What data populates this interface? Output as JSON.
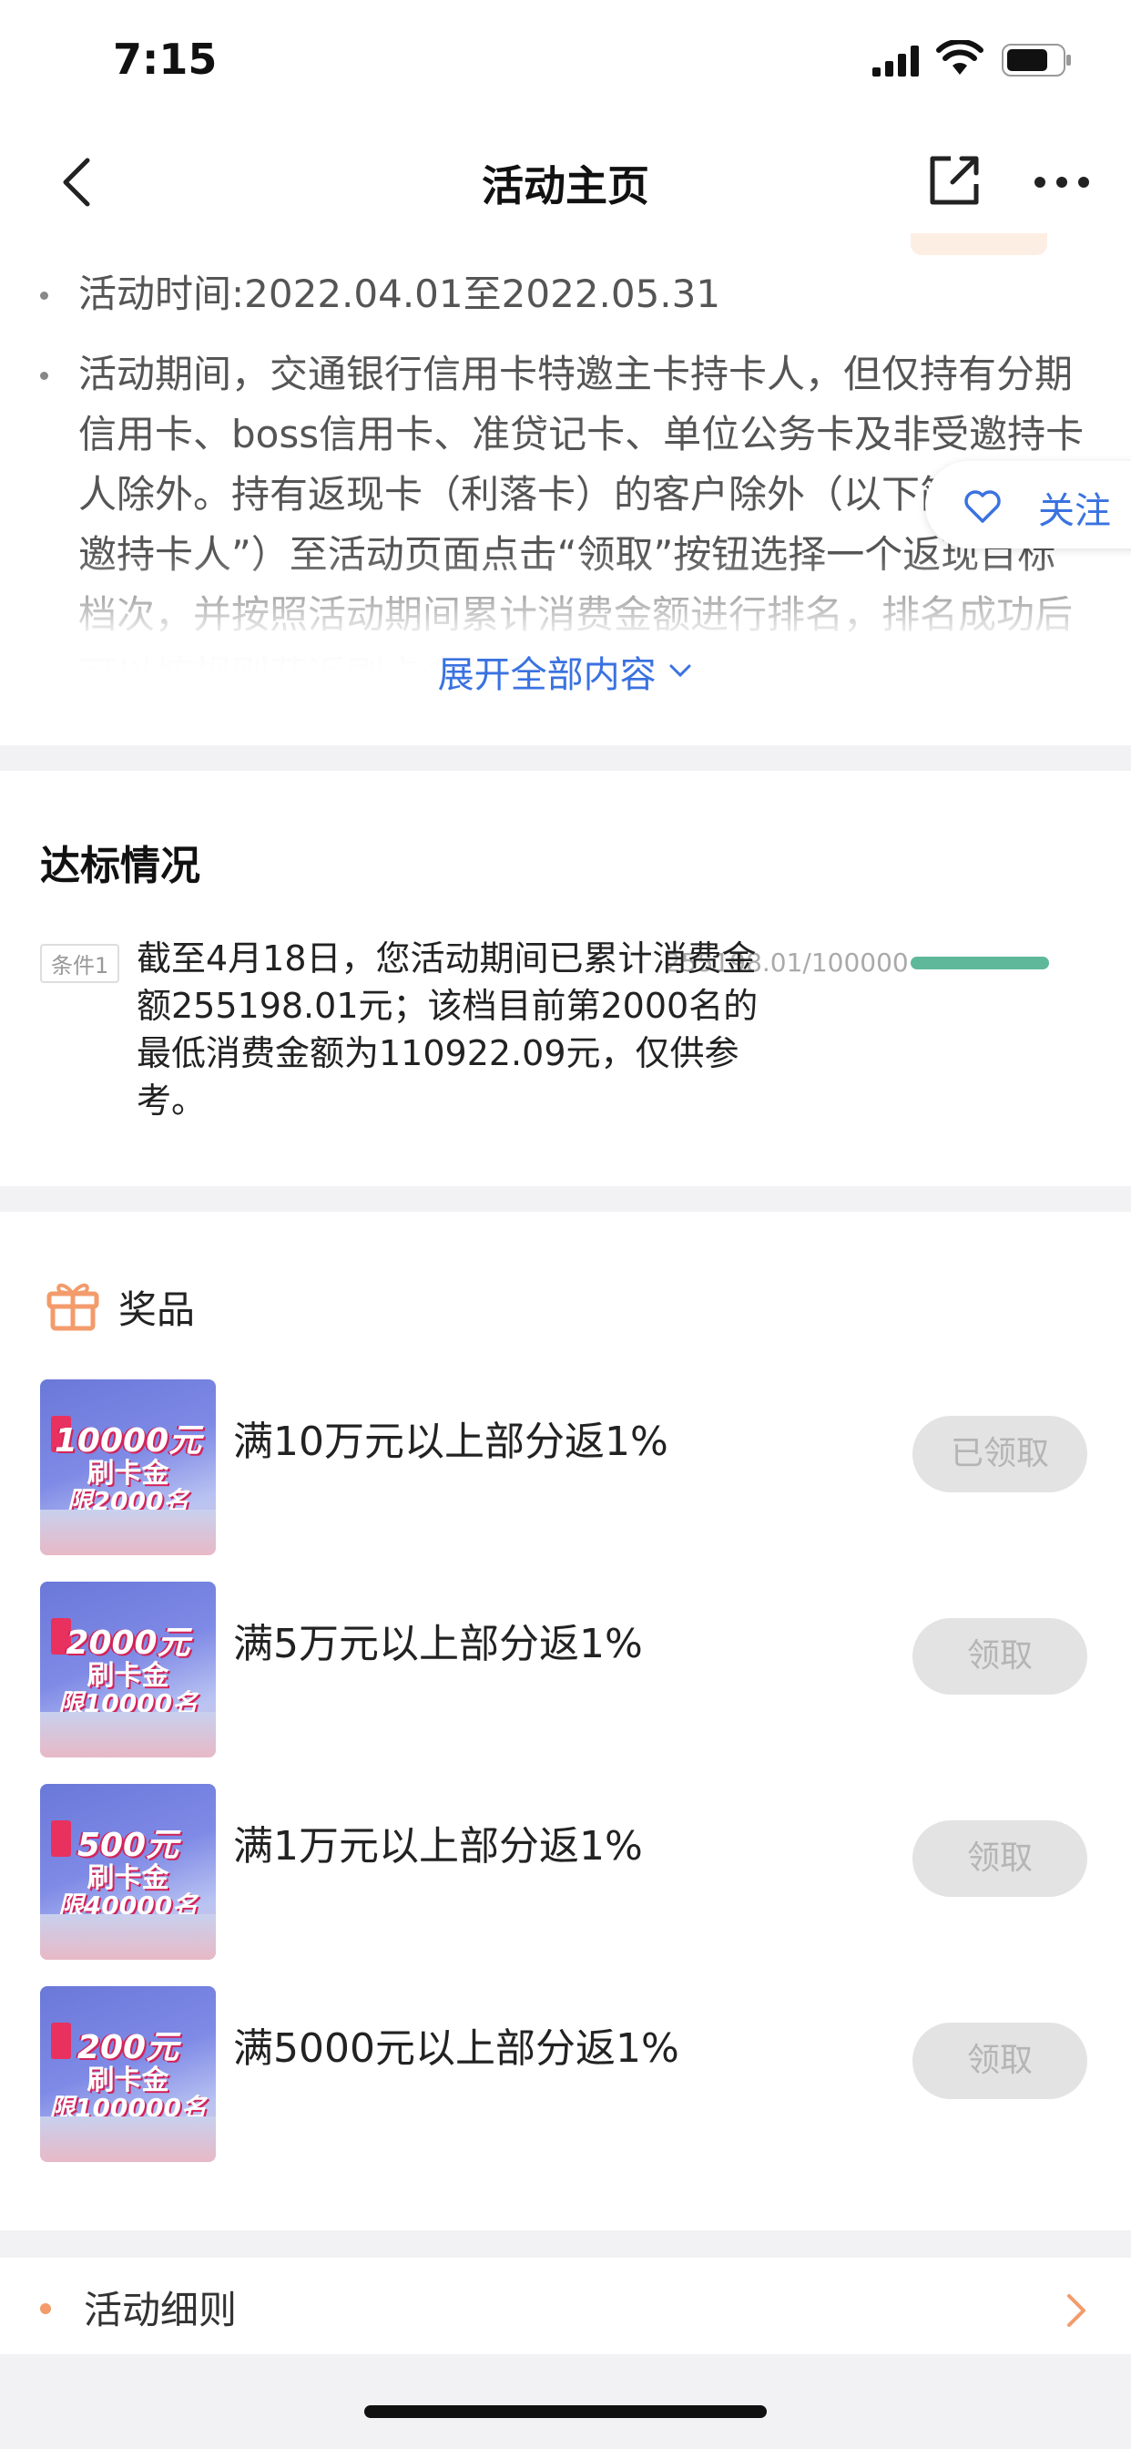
{
  "status": {
    "time": "7:15"
  },
  "nav": {
    "title": "活动主页"
  },
  "rules": {
    "items": [
      "活动时间:2022.04.01至2022.05.31",
      "活动期间，交通银行信用卡特邀主卡持卡人，但仅持有分期信用卡、boss信用卡、准贷记卡、单位公务卡及非受邀持卡人除外。持有返现卡（利落卡）的客户除外（以下简称“特邀持卡人”）至活动页面点击“领取”按钮选择一个返现目标档次，并按照活动期间累计消费金额进行排名，排名成功后可以按规则获返刷卡金奖励"
    ],
    "expand_label": "展开全部内容"
  },
  "follow": {
    "label": "关注"
  },
  "status_section": {
    "title": "达标情况",
    "condition": {
      "badge": "条件1",
      "text": "截至4月18日，您活动期间已累计消费金额255198.01元；该档目前第2000名的最低消费金额为110922.09元，仅供参考。",
      "ratio": "255198.01/100000",
      "progress": 1.0
    }
  },
  "prizes": {
    "title": "奖品",
    "items": [
      {
        "amount": "10000元",
        "sub": "刷卡金",
        "limit": "限2000名",
        "name": "满10万元以上部分返1%",
        "button": "已领取"
      },
      {
        "amount": "2000元",
        "sub": "刷卡金",
        "limit": "限10000名",
        "name": "满5万元以上部分返1%",
        "button": "领取"
      },
      {
        "amount": "500元",
        "sub": "刷卡金",
        "limit": "限40000名",
        "name": "满1万元以上部分返1%",
        "button": "领取"
      },
      {
        "amount": "200元",
        "sub": "刷卡金",
        "limit": "限100000名",
        "name": "满5000元以上部分返1%",
        "button": "领取"
      }
    ]
  },
  "footer": {
    "label": "活动细则"
  },
  "colors": {
    "accent_blue": "#3a72e0",
    "progress_green": "#5fb89a",
    "gift_orange": "#f39b6b"
  }
}
